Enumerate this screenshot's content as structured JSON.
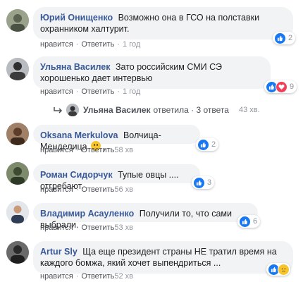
{
  "action_labels": {
    "like": "нравится",
    "reply": "Ответить"
  },
  "comments": [
    {
      "author": "Юрий Онищенко",
      "text": "Возможно она в ГСО на полставки охранником халтурит.",
      "time": "1 год",
      "reactions": [
        "like-icon"
      ],
      "count": "2",
      "avatar_color": "#7c8a6e"
    },
    {
      "author": "Ульяна Василек",
      "text": "Зато российским СМИ СЭ хорошенько дает интервью",
      "time": "1 год",
      "reactions": [
        "like-icon",
        "love-icon"
      ],
      "count": "9",
      "avatar_color": "#8a8f94"
    },
    {
      "author": "Oksana Merkulova",
      "text": "Волчица-Менделица",
      "emoji": "smile-emoji",
      "text_after": ".",
      "time": "58 хв",
      "reactions": [
        "like-icon"
      ],
      "count": "2",
      "avatar_color": "#6e5a44"
    },
    {
      "author": "Роман Сидорчук",
      "text": "Тупые овцы .... отгребают.",
      "time": "56 хв",
      "reactions": [
        "like-icon"
      ],
      "count": "3",
      "avatar_color": "#5d6b50"
    },
    {
      "author": "Владимир Асауленко",
      "text": "Получили то, что сами выбрали.",
      "time": "53 хв",
      "reactions": [
        "like-icon"
      ],
      "count": "6",
      "avatar_color": "#d9dde2"
    },
    {
      "author": "Artur Sly",
      "text": "Ща еще президент страны НЕ тратил время на каждого бомжа, який хочет выпендриться ...",
      "time": "52 хв",
      "reactions": [
        "like-icon",
        "sad-icon"
      ],
      "count": "",
      "avatar_color": "#4f4f4f"
    }
  ],
  "replies": {
    "name": "Ульяна Василек",
    "label": "ответила · 3 ответа",
    "time": "43 хв."
  }
}
